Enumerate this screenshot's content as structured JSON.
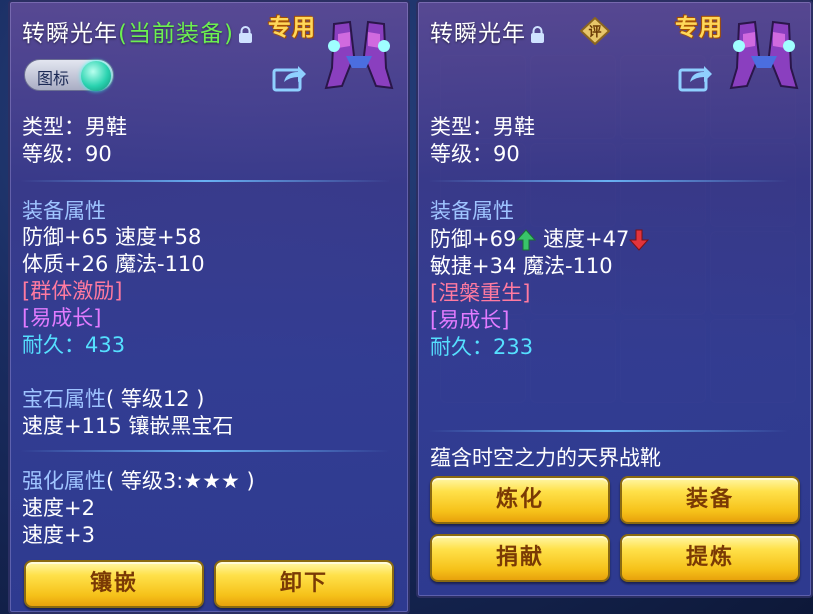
{
  "left_panel": {
    "title": "转瞬光年",
    "title_suffix": "(当前装备)",
    "special_badge": "专用",
    "icon_toggle_label": "图标",
    "type_line": "类型：男鞋",
    "level_line": "等级：90",
    "equip_attr_header": "装备属性",
    "attr_line_1": "防御+65 速度+58",
    "attr_line_2": "体质+26 魔法-110",
    "special_effect": "[群体激励]",
    "special_skill": "[易成长]",
    "durability_label": "耐久：",
    "durability_value": "433",
    "gem_header": "宝石属性",
    "gem_level": "( 等级12 )",
    "gem_line": "速度+115 镶嵌黑宝石",
    "enhance_header": "强化属性",
    "enhance_level": "( 等级3:★★★ )",
    "enhance_line_1": "速度+2",
    "enhance_line_2": "速度+3",
    "buttons": [
      "镶嵌",
      "卸下"
    ]
  },
  "right_panel": {
    "title": "转瞬光年",
    "appraise_badge": "评",
    "special_badge": "专用",
    "type_line": "类型：男鞋",
    "level_line": "等级：90",
    "equip_attr_header": "装备属性",
    "attr_defense": "防御+69",
    "attr_speed": "速度+47",
    "attr_line_2": "敏捷+34 魔法-110",
    "special_effect": "[涅槃重生]",
    "special_skill": "[易成长]",
    "durability_label": "耐久：",
    "durability_value": "233",
    "description": "蕴含时空之力的天界战靴",
    "buttons": [
      "炼化",
      "装备",
      "捐献",
      "提炼"
    ]
  },
  "colors": {
    "accent_yellow": "#f6c21a",
    "attr_up": "#39c46a",
    "attr_down": "#e2343c",
    "durability": "#55e0ff",
    "effect": "#ff7aa0",
    "skill": "#e27bff"
  },
  "icons": [
    "lock-icon",
    "share-icon",
    "boots-icon",
    "arrow-up-icon",
    "arrow-down-icon",
    "appraise-icon"
  ]
}
